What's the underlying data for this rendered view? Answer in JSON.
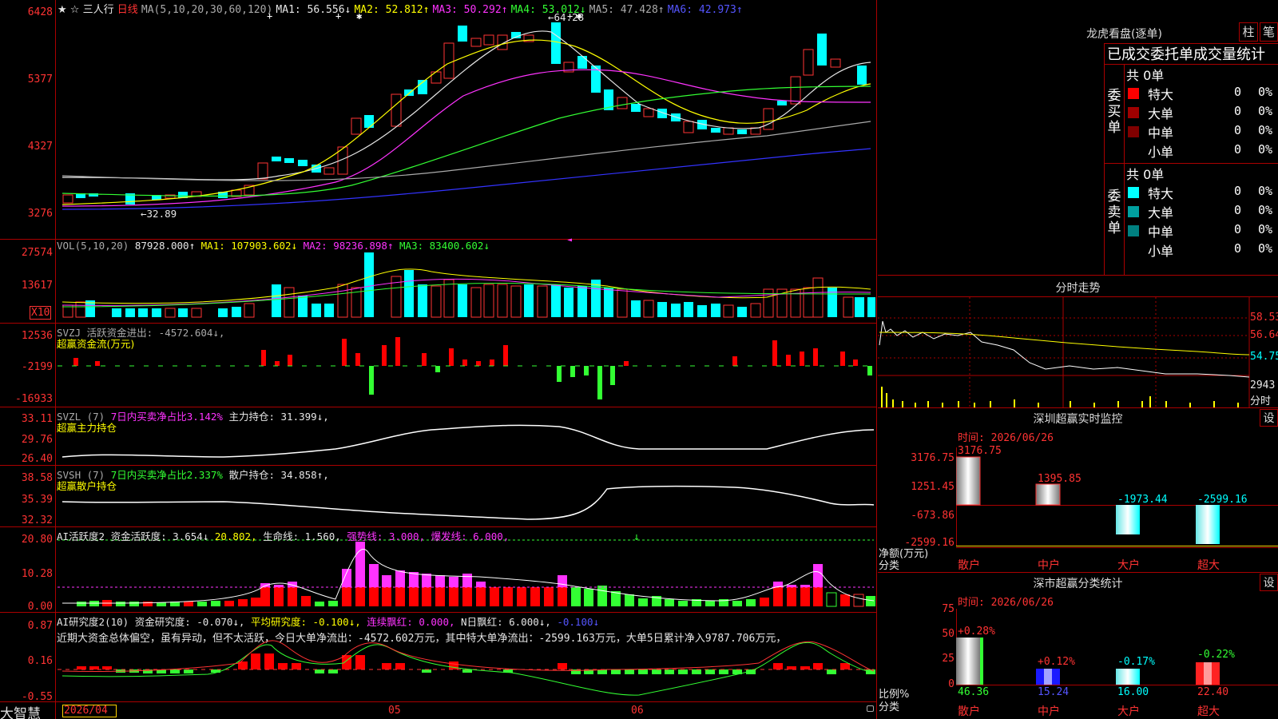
{
  "stock": {
    "name": "三人行",
    "period": "日线",
    "star": "★",
    "marker": "☆"
  },
  "ma_legend": {
    "spec": "MA(5,10,20,30,60,120)",
    "ma1": "MA1: 56.556↓",
    "ma2": "MA2: 52.812↑",
    "ma3": "MA3: 50.292↑",
    "ma4": "MA4: 53.012↓",
    "ma5": "MA5: 47.428↑",
    "ma6": "MA6: 42.973↑"
  },
  "price_axis": [
    "6428",
    "5377",
    "4327",
    "3276"
  ],
  "price_notes": {
    "high": "64.28",
    "low": "32.89"
  },
  "vol": {
    "legend": "VOL(5,10,20)",
    "val": "87928.000↑",
    "ma1": "MA1: 107903.602↓",
    "ma2": "MA2: 98236.898↑",
    "ma3": "MA3: 83400.602↓",
    "axis": [
      "27574",
      "13617"
    ],
    "unit": "X10"
  },
  "svzj": {
    "legend": "SVZJ  活跃资金进出: -4572.604↓,",
    "sub": "超赢资金流(万元)",
    "axis": [
      "12536",
      "-2199",
      "-16933"
    ]
  },
  "svzl": {
    "legend": "SVZL (7)",
    "pct": "7日内买卖净占比3.142%",
    "hold": "主力持仓: 31.399↓,",
    "sub": "超赢主力持仓",
    "axis": [
      "33.11",
      "29.76",
      "26.40"
    ]
  },
  "svsh": {
    "legend": "SVSH (7)",
    "pct": "7日内买卖净占比2.337%",
    "hold": "散户持仓: 34.858↑,",
    "sub": "超赢散户持仓",
    "axis": [
      "38.58",
      "35.39",
      "32.32"
    ]
  },
  "ai_active": {
    "legend": "AI活跃度2 资金活跃度: 3.654↓",
    "v2": "20.802,",
    "life": "生命线: 1.560,",
    "strong": "强势线: 3.000,",
    "burst": "爆发线: 6.000,",
    "axis": [
      "20.80",
      "10.28",
      "0.00"
    ]
  },
  "ai_research": {
    "legend": "AI研究度2(10) 资金研究度: -0.070↓,",
    "avg": "平均研究度: -0.100↓,",
    "red": "连续飘红: 0.000,",
    "nred": "N日飘红: 6.000↓,",
    "last": "-0.100↓",
    "commentary": "近期大资金总体偏空，虽有异动，但不太活跃，今日大单净流出：-4572.602万元，其中特大单净流出：-2599.163万元，大单5日累计净入9787.706万元，",
    "axis": [
      "0.87",
      "0.16",
      "-0.55"
    ]
  },
  "date_axis": [
    "2026/04",
    "05",
    "06"
  ],
  "brand": "大智慧",
  "right": {
    "lhb_title": "龙虎看盘(逐单)",
    "tab1": "柱",
    "tab2": "笔",
    "orders_title": "已成交委托单成交量统计",
    "buy_label": "委买单",
    "sell_label": "委卖单",
    "buy_total": "共 0单",
    "sell_total": "共 0单",
    "buy_rows": [
      {
        "name": "特大",
        "count": "0",
        "pct": "0%",
        "color": "#ff0000"
      },
      {
        "name": "大单",
        "count": "0",
        "pct": "0%",
        "color": "#a00000"
      },
      {
        "name": "中单",
        "count": "0",
        "pct": "0%",
        "color": "#800000"
      },
      {
        "name": "小单",
        "count": "0",
        "pct": "0%",
        "color": ""
      }
    ],
    "sell_rows": [
      {
        "name": "特大",
        "count": "0",
        "pct": "0%",
        "color": "#00ffff"
      },
      {
        "name": "大单",
        "count": "0",
        "pct": "0%",
        "color": "#00a0a0"
      },
      {
        "name": "中单",
        "count": "0",
        "pct": "0%",
        "color": "#008080"
      },
      {
        "name": "小单",
        "count": "0",
        "pct": "0%",
        "color": ""
      }
    ],
    "intraday_title": "分时走势",
    "intraday_axis": [
      "58.53",
      "56.64",
      "54.75",
      "2943",
      "分时"
    ],
    "sz_title": "深圳超赢实时监控",
    "set": "设",
    "date": "时间: 2026/06/26",
    "sz_axis": [
      "3176.75",
      "1251.45",
      "-673.86",
      "-2599.16"
    ],
    "sz_unit": [
      "净额(万元)",
      "分类"
    ],
    "sz_bars": [
      {
        "cat": "散户",
        "value": "3176.75"
      },
      {
        "cat": "中户",
        "value": "1395.85"
      },
      {
        "cat": "大户",
        "value": "-1973.44"
      },
      {
        "cat": "超大",
        "value": "-2599.16"
      }
    ],
    "cls_title": "深市超赢分类统计",
    "cls_axis": [
      "75",
      "50",
      "25",
      "0"
    ],
    "cls_unit": [
      "比例%",
      "分类"
    ],
    "cls_bars": [
      {
        "cat": "散户",
        "chg": "+0.28%",
        "value": "46.36"
      },
      {
        "cat": "中户",
        "chg": "+0.12%",
        "value": "15.24"
      },
      {
        "cat": "大户",
        "chg": "-0.17%",
        "value": "16.00"
      },
      {
        "cat": "超大",
        "chg": "-0.22%",
        "value": "22.40"
      }
    ]
  }
}
